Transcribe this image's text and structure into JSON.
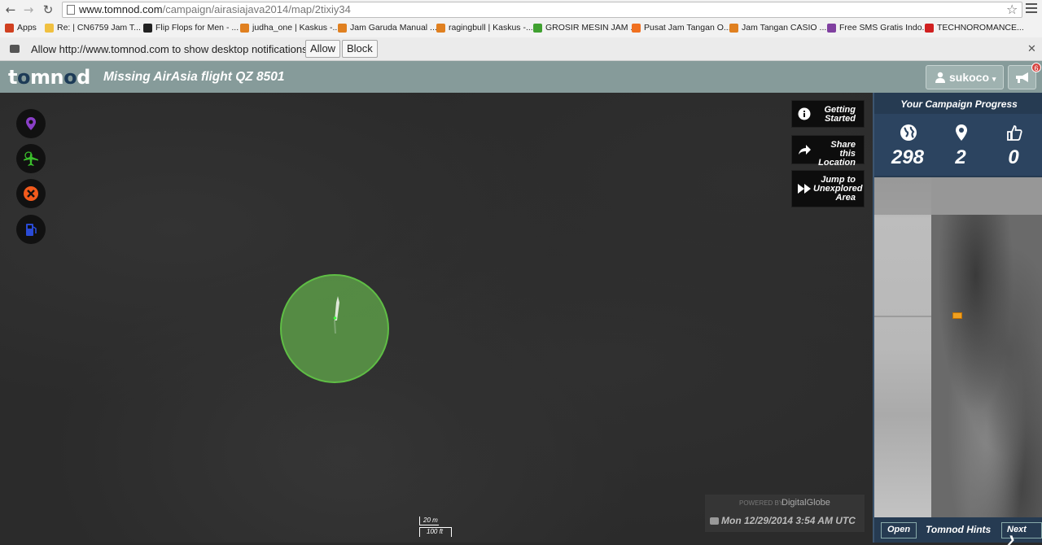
{
  "browser": {
    "url_host": "www.tomnod.com",
    "url_path": "/campaign/airasiajava2014/map/2tixiy34",
    "bookmarks": [
      {
        "label": "Apps",
        "color": "#d04020"
      },
      {
        "label": "Re: | CN6759 Jam T...",
        "color": "#f0c040"
      },
      {
        "label": "Flip Flops for Men - ...",
        "color": "#222222"
      },
      {
        "label": "judha_one | Kaskus -...",
        "color": "#e08020"
      },
      {
        "label": "Jam Garuda Manual ...",
        "color": "#e08020"
      },
      {
        "label": "ragingbull | Kaskus -...",
        "color": "#e08020"
      },
      {
        "label": "GROSIR MESIN JAM ...",
        "color": "#40a030"
      },
      {
        "label": "Pusat Jam Tangan O...",
        "color": "#f07020"
      },
      {
        "label": "Jam Tangan CASIO ...",
        "color": "#e08020"
      },
      {
        "label": "Free SMS Gratis Indo...",
        "color": "#8040a0"
      },
      {
        "label": "TECHNOROMANCE...",
        "color": "#d02020"
      }
    ],
    "notification": {
      "message": "Allow http://www.tomnod.com to show desktop notifications?",
      "allow": "Allow",
      "block": "Block"
    }
  },
  "app": {
    "logo": "tomnod",
    "title": "Missing AirAsia flight QZ 8501",
    "user": "sukoco",
    "notification_count": "6"
  },
  "map": {
    "tools": [
      {
        "name": "location-pin-tool",
        "color": "#8a3fc7"
      },
      {
        "name": "plane-wreckage-tool",
        "color": "#3bbf2c"
      },
      {
        "name": "damage-tool",
        "color": "#f25a1c"
      },
      {
        "name": "fuel-tool",
        "color": "#2a4bd6"
      }
    ],
    "buttons": {
      "getting_started": "Getting Started",
      "share_location": "Share this Location",
      "jump_unexplored": "Jump to Unexplored Area"
    },
    "scale_top": "20 m",
    "scale_bottom": "100 ft",
    "powered_by": "POWERED BY",
    "imagery_brand": "DigitalGlobe",
    "capture_date": "Mon 12/29/2014 3:54 AM UTC"
  },
  "sidebar": {
    "title": "Your Campaign Progress",
    "stats": {
      "explored": "298",
      "tags": "2",
      "votes": "0"
    },
    "footer": {
      "open": "Open",
      "hints": "Tomnod Hints",
      "next": "Next"
    }
  }
}
